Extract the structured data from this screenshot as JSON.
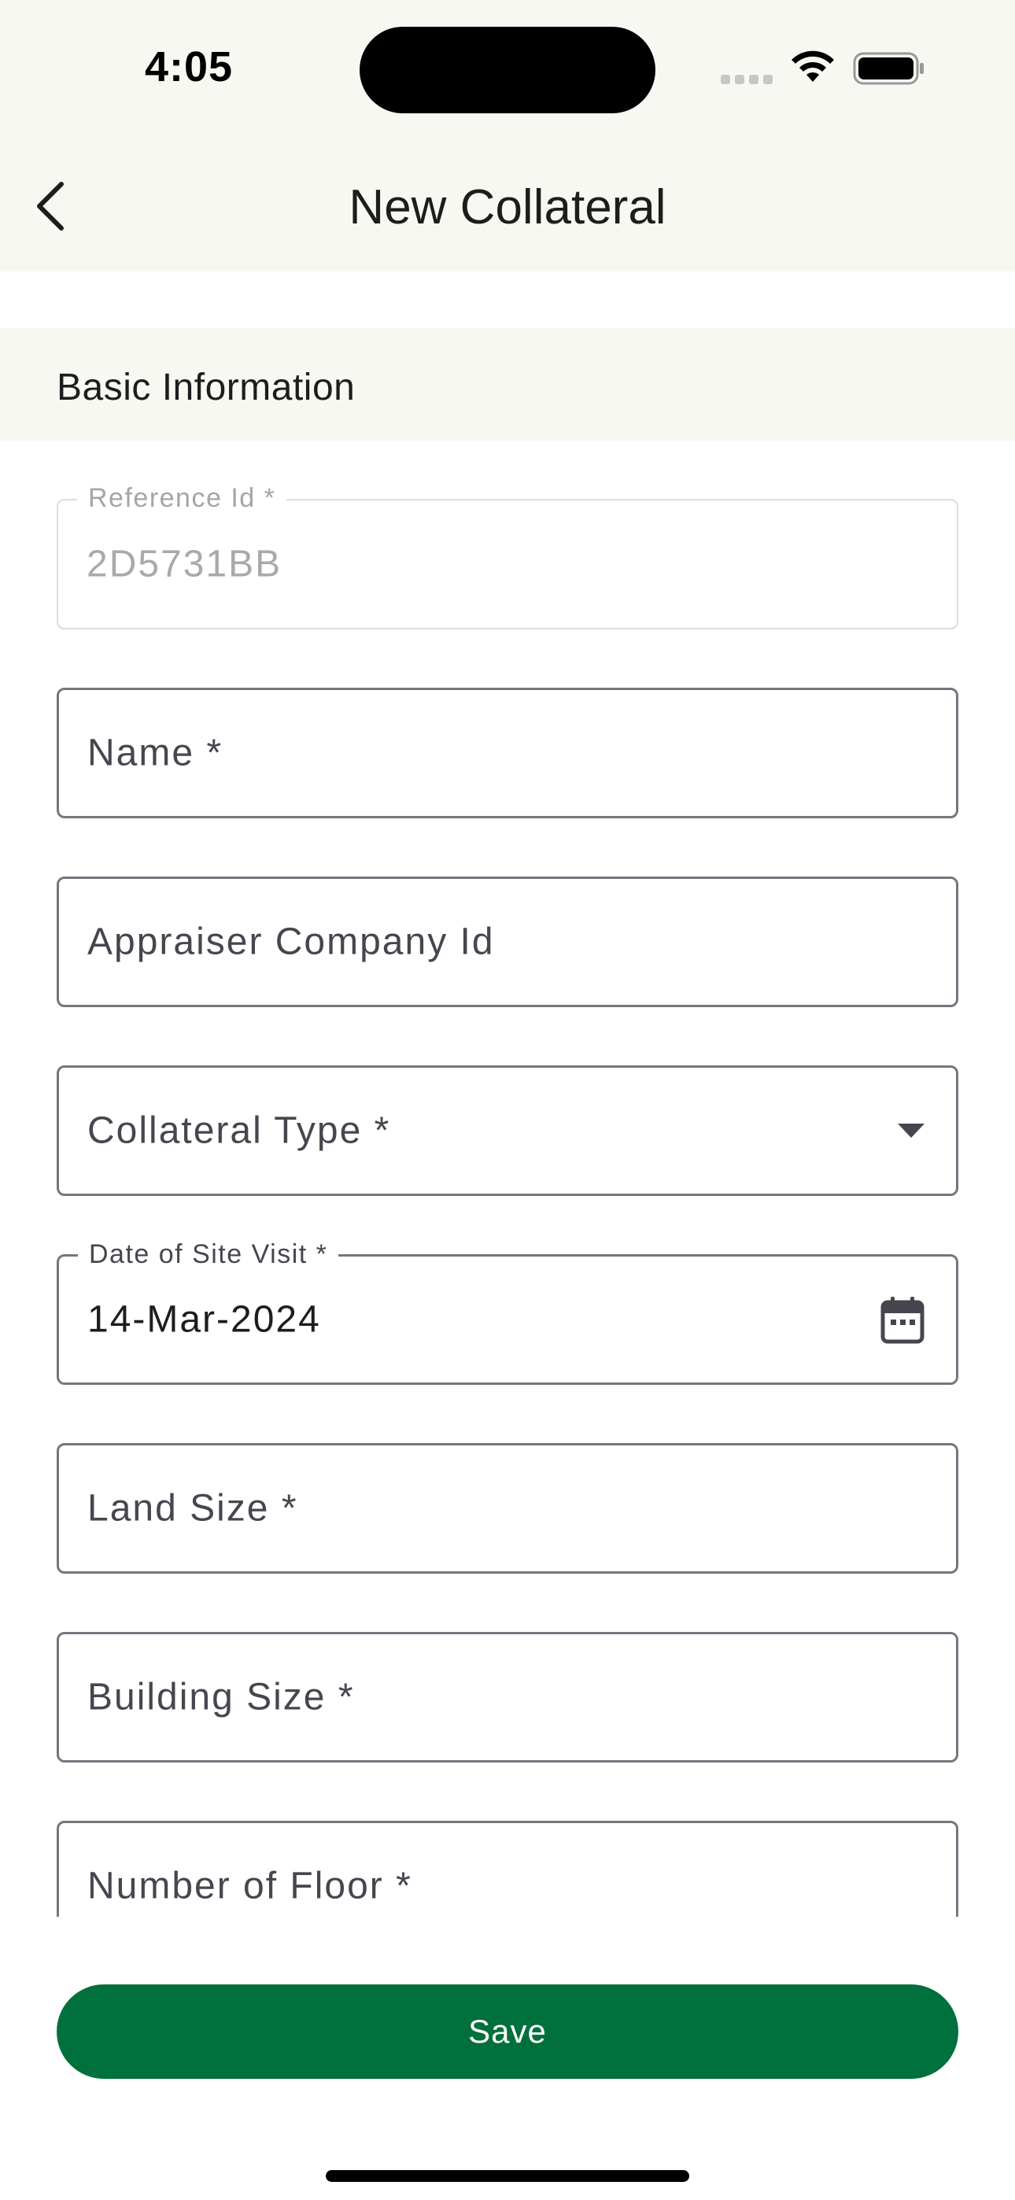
{
  "status_bar": {
    "time": "4:05"
  },
  "nav": {
    "title": "New Collateral"
  },
  "section": {
    "title": "Basic Information"
  },
  "form": {
    "reference_id": {
      "label": "Reference Id *",
      "value": "2D5731BB"
    },
    "name": {
      "label": "Name *"
    },
    "appraiser_company_id": {
      "label": "Appraiser Company Id"
    },
    "collateral_type": {
      "label": "Collateral Type *"
    },
    "date_of_site_visit": {
      "label": "Date of Site Visit *",
      "value": "14-Mar-2024"
    },
    "land_size": {
      "label": "Land Size *"
    },
    "building_size": {
      "label": "Building Size *"
    },
    "number_of_floor": {
      "label": "Number of Floor *"
    }
  },
  "actions": {
    "save_label": "Save"
  },
  "colors": {
    "accent": "#00703c",
    "header_bg": "#f8f8f3",
    "field_border": "#79747e"
  }
}
